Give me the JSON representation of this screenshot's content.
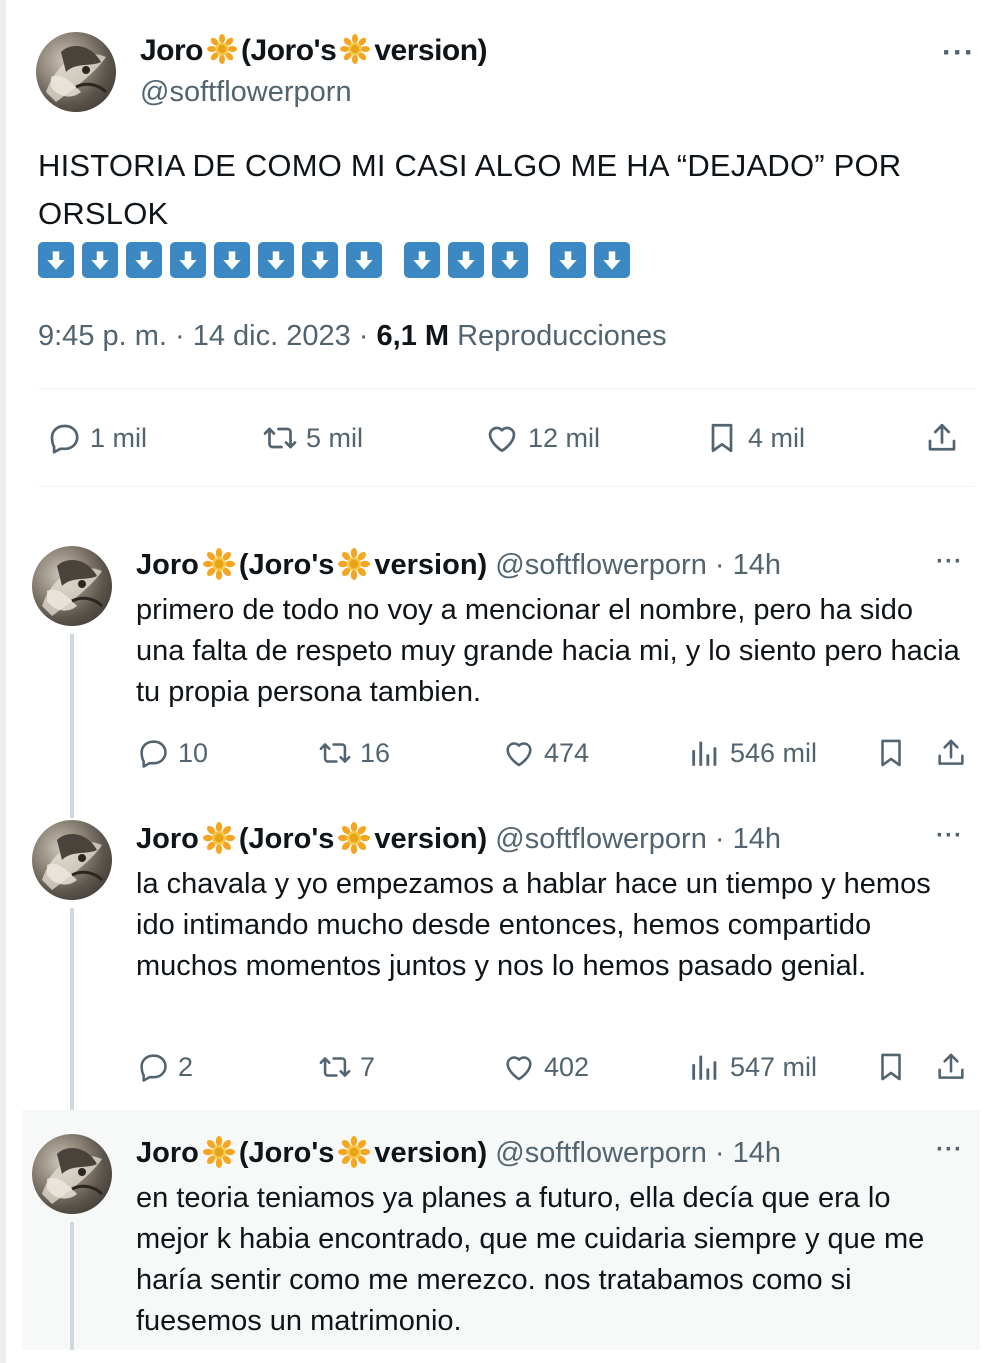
{
  "main_tweet": {
    "display_name_parts": [
      "Joro",
      "(Joro's",
      "version)"
    ],
    "handle": "@softflowerporn",
    "text": "HISTORIA DE COMO MI CASI ALGO ME HA “DEJADO” POR ORSLOK",
    "arrow_emoji_count": 13,
    "time": "9:45 p. m. · 14 dic. 2023 · ",
    "views_count": "6,1 M",
    "views_label": " Reproducciones",
    "stats": {
      "replies": "1 mil",
      "retweets": "5 mil",
      "likes": "12 mil",
      "bookmarks": "4 mil"
    }
  },
  "replies": [
    {
      "name_parts": [
        "Joro",
        "(Joro's",
        "version)"
      ],
      "handle_time": "@softflowerporn · 14h",
      "text": "primero de todo no voy a mencionar el nombre, pero ha sido una falta de respeto muy grande hacia mi, y lo siento pero hacia tu propia persona tambien.",
      "replies": "10",
      "retweets": "16",
      "likes": "474",
      "views": "546 mil"
    },
    {
      "name_parts": [
        "Joro",
        "(Joro's",
        "version)"
      ],
      "handle_time": "@softflowerporn · 14h",
      "text": "la chavala y yo empezamos a hablar hace un tiempo y hemos ido intimando mucho desde entonces, hemos compartido muchos momentos juntos y nos lo hemos pasado genial.",
      "replies": "2",
      "retweets": "7",
      "likes": "402",
      "views": "547 mil"
    },
    {
      "name_parts": [
        "Joro",
        "(Joro's",
        "version)"
      ],
      "handle_time": "@softflowerporn · 14h",
      "text": "en teoria teniamos ya planes a futuro, ella decía que era lo mejor k habia encontrado, que me cuidaria siempre y que me haría sentir como me merezco. nos tratabamos como si fuesemos un matrimonio."
    }
  ],
  "icons": {
    "more": "more-dots-icon",
    "reply": "reply-icon",
    "retweet": "retweet-icon",
    "like": "heart-icon",
    "bookmark": "bookmark-icon",
    "share": "share-icon",
    "views": "views-icon",
    "flower": "sunflower-emoji",
    "arrow": "down-arrow-emoji"
  },
  "colors": {
    "text": "#0f1419",
    "secondary": "#536471",
    "arrow_bg": "#3b88c3",
    "thread_line": "#cfd9de"
  }
}
